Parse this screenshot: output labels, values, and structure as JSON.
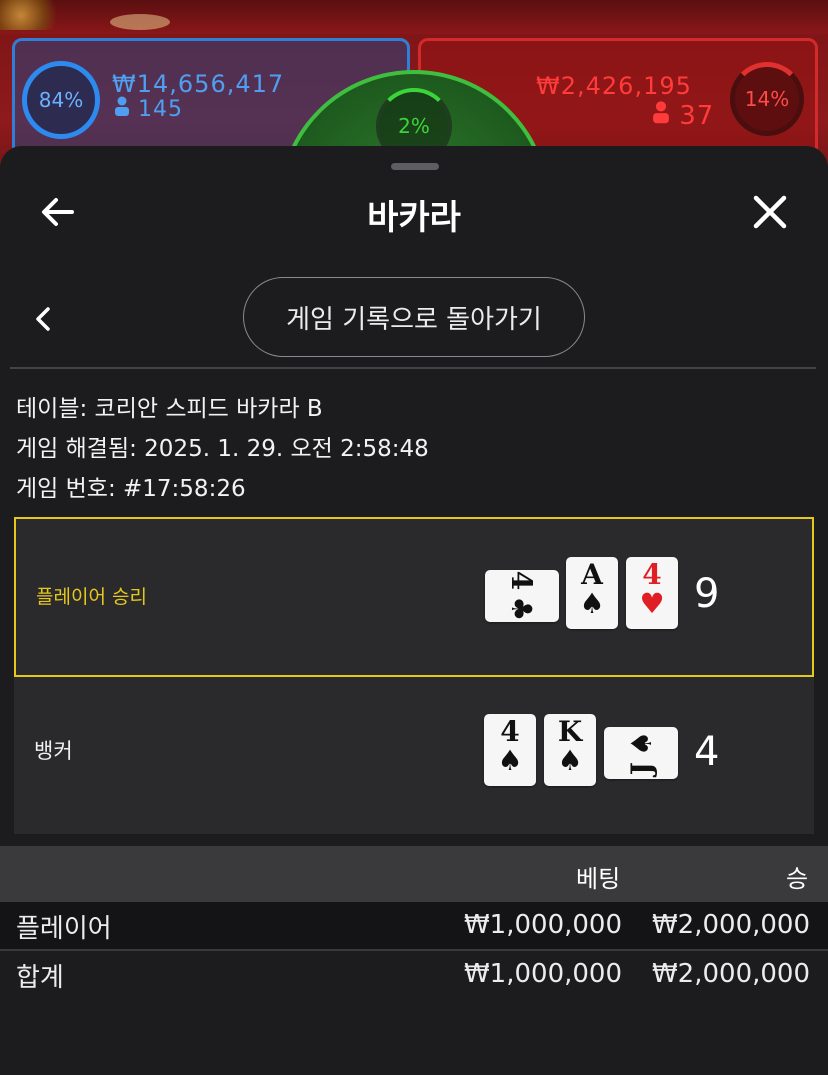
{
  "background": {
    "player_percent": "84%",
    "player_amount": "₩14,656,417",
    "player_count": "145",
    "tie_percent": "2%",
    "banker_amount": "₩2,426,195",
    "banker_count": "37",
    "banker_percent": "14%"
  },
  "header": {
    "title": "바카라",
    "back_icon": "arrow-left-icon",
    "close_icon": "close-icon"
  },
  "nav": {
    "back_to_history_label": "게임 기록으로 돌아가기",
    "chevron_icon": "chevron-left-icon"
  },
  "info": {
    "table": "테이블: 코리안 스피드 바카라 B",
    "resolved": "게임 해결됨: 2025. 1. 29. 오전 2:58:48",
    "game_number": "게임 번호: #17:58:26"
  },
  "hands": {
    "player": {
      "label": "플레이어 승리",
      "score": "9",
      "cards": [
        {
          "rank": "4",
          "suit": "♣",
          "orientation": "horizontal"
        },
        {
          "rank": "A",
          "suit": "♠",
          "orientation": "vertical"
        },
        {
          "rank": "4",
          "suit": "♥",
          "orientation": "vertical"
        }
      ]
    },
    "banker": {
      "label": "뱅커",
      "score": "4",
      "cards": [
        {
          "rank": "4",
          "suit": "♠",
          "orientation": "vertical"
        },
        {
          "rank": "K",
          "suit": "♠",
          "orientation": "vertical"
        },
        {
          "rank": "J",
          "suit": "♠",
          "orientation": "horizontal"
        }
      ]
    }
  },
  "bets_table": {
    "headers": {
      "bet": "베팅",
      "win": "승"
    },
    "rows": [
      {
        "name": "플레이어",
        "bet": "₩1,000,000",
        "win": "₩2,000,000"
      },
      {
        "name": "합계",
        "bet": "₩1,000,000",
        "win": "₩2,000,000"
      }
    ]
  },
  "colors": {
    "accent_gold": "#e6c71c",
    "suit_red": "#e01f25",
    "player_blue": "#2d8bf0",
    "banker_red": "#d32b2b",
    "tie_green": "#3fbf3f"
  }
}
